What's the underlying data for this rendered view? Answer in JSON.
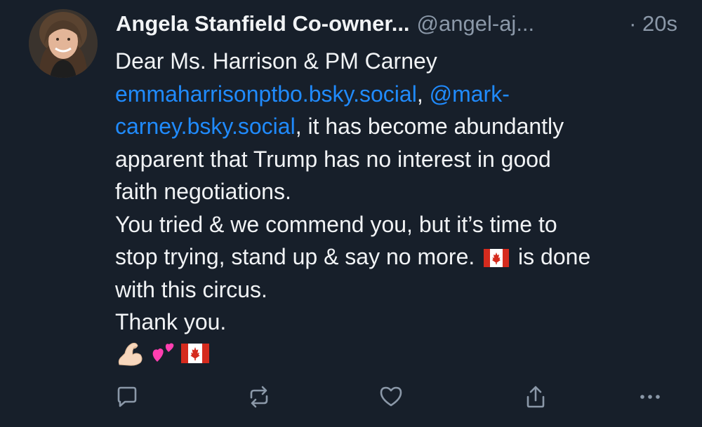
{
  "post": {
    "author": {
      "display_name": "Angela Stanfield Co-owner...",
      "handle": "@angel-aj...",
      "timestamp": "· 20s"
    },
    "text": {
      "line1": "Dear Ms. Harrison & PM Carney",
      "mention1": "emmaharrisonptbo.bsky.social",
      "comma": ",",
      "mention2_part1": "@mark-",
      "mention2_part2": "carney.bsky.social",
      "line3_rest": ", it has become abundantly",
      "line4": "apparent that Trump has no interest in good",
      "line5": "faith negotiations.",
      "line6": "You tried & we commend you, but it’s time to",
      "line7_a": "stop trying, stand up & say no more.",
      "line7_b": "is done",
      "line8": "with this circus.",
      "line9": "Thank you."
    },
    "emojis": [
      "flexed-biceps",
      "two-hearts",
      "canada-flag"
    ],
    "actions": [
      "reply",
      "repost",
      "like",
      "share",
      "more"
    ],
    "colors": {
      "background": "#171f2a",
      "text": "#f1f3f5",
      "muted": "#8b98a8",
      "link": "#208bfe"
    }
  }
}
